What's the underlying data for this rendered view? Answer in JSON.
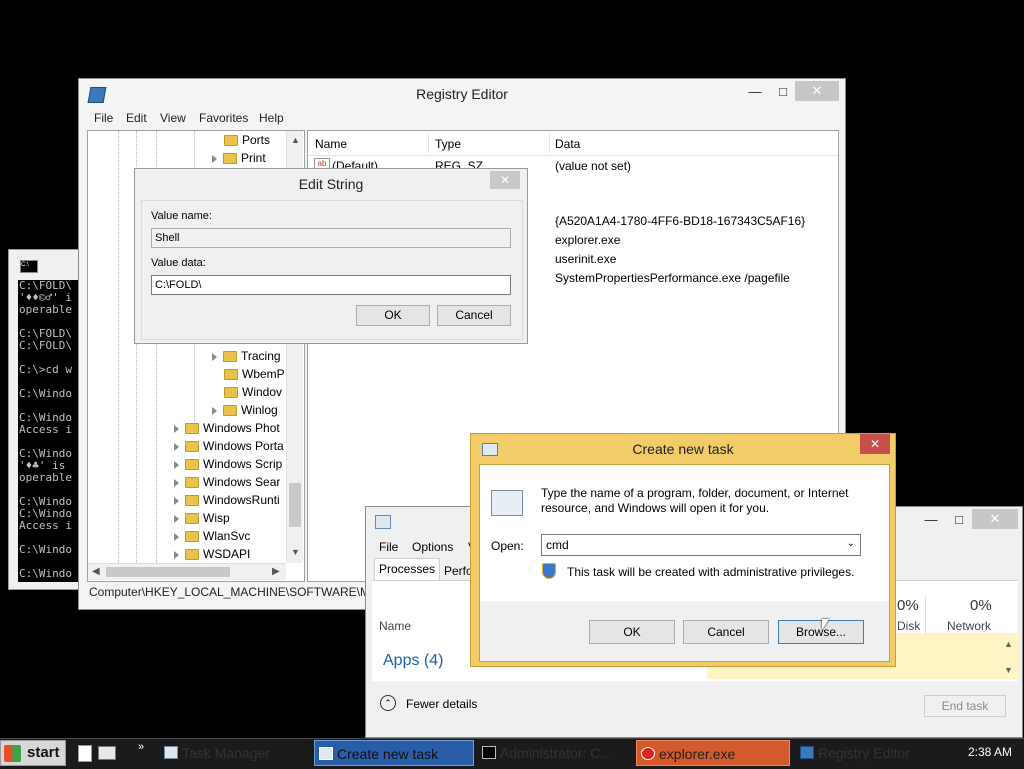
{
  "console": {
    "lines": [
      "C:\\FOLD\\",
      "'♦♦©♂' i",
      "operable",
      "",
      "C:\\FOLD\\",
      "C:\\FOLD\\",
      "",
      "C:\\>cd w",
      "",
      "C:\\Windo",
      "",
      "C:\\Windo",
      "Access i",
      "",
      "C:\\Windo",
      "'♦♣' is",
      "operable",
      "",
      "C:\\Windo",
      "C:\\Windo",
      "Access i",
      "",
      "C:\\Windo",
      "",
      "C:\\Windo"
    ]
  },
  "registry": {
    "title": "Registry Editor",
    "menu": [
      "File",
      "Edit",
      "View",
      "Favorites",
      "Help"
    ],
    "tree_top": [
      {
        "label": "Ports",
        "expander": false
      },
      {
        "label": "Print",
        "expander": true
      }
    ],
    "tree_mid": [
      {
        "label": "Tracing",
        "expander": true
      },
      {
        "label": "WbemP",
        "expander": false
      },
      {
        "label": "Windov",
        "expander": false
      },
      {
        "label": "Winlog",
        "expander": true
      }
    ],
    "tree_bottom": [
      "Windows Phot",
      "Windows Porta",
      "Windows Scrip",
      "Windows Sear",
      "WindowsRunti",
      "Wisp",
      "WlanSvc",
      "WSDAPI"
    ],
    "columns": {
      "name": "Name",
      "type": "Type",
      "data": "Data"
    },
    "default_row": {
      "name": "(Default)",
      "type": "REG_SZ",
      "data": "(value not set)"
    },
    "data_values": [
      "{A520A1A4-1780-4FF6-BD18-167343C5AF16}",
      "explorer.exe",
      "userinit.exe",
      "SystemPropertiesPerformance.exe /pagefile"
    ],
    "status": "Computer\\HKEY_LOCAL_MACHINE\\SOFTWARE\\Mic"
  },
  "edit_string": {
    "title": "Edit String",
    "value_name_label": "Value name:",
    "value_name": "Shell",
    "value_data_label": "Value data:",
    "value_data": "C:\\FOLD\\",
    "ok": "OK",
    "cancel": "Cancel"
  },
  "task_manager": {
    "menu": [
      "File",
      "Options",
      "V"
    ],
    "tabs": [
      "Processes",
      "Perfo"
    ],
    "name_col": "Name",
    "apps": "Apps (4)",
    "disk_pct": "0%",
    "disk": "Disk",
    "network_pct": "0%",
    "network": "Network",
    "fewer_details": "Fewer details",
    "end_task": "End task"
  },
  "create_task": {
    "title": "Create new task",
    "description": "Type the name of a program, folder, document, or Internet resource, and Windows will open it for you.",
    "open_label": "Open:",
    "open_value": "cmd",
    "admin_note": "This task will be created with administrative privileges.",
    "ok": "OK",
    "cancel": "Cancel",
    "browse": "Browse..."
  },
  "taskbar": {
    "start": "start",
    "items": [
      "Task Manager",
      "Create new task",
      "Administrator: C...",
      "explorer.exe",
      "Registry Editor"
    ],
    "clock": "2:38 AM"
  },
  "colors": {
    "desktop": "#000000",
    "create_task_frame": "#f3cc6a",
    "close_red": "#c7504b",
    "taskbar": "#1b1b1b",
    "active_task": "#2a5da8",
    "error_task": "#d35a2a"
  }
}
